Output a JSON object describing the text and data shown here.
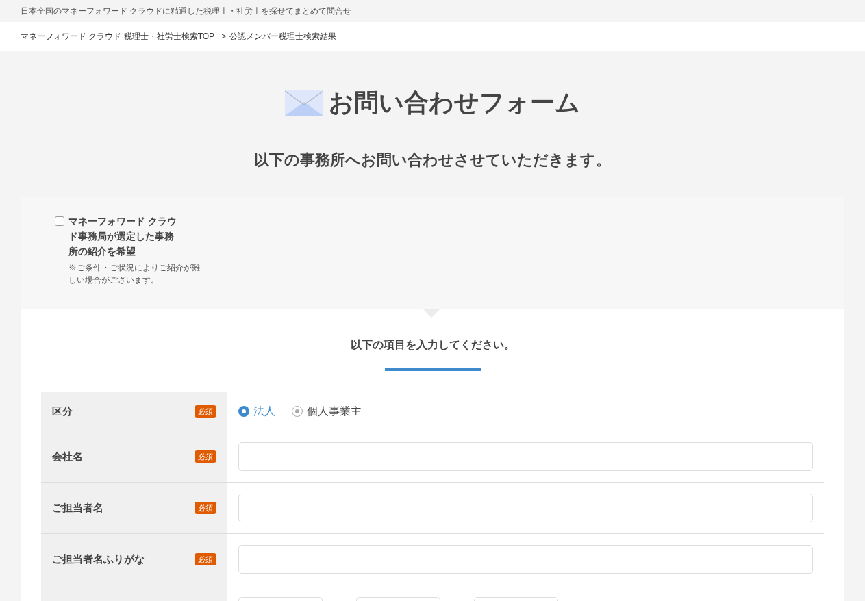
{
  "header": {
    "tagline": "日本全国のマネーフォワード クラウドに精通した税理士・社労士を探せてまとめて問合せ"
  },
  "breadcrumb": {
    "separator": ">",
    "items": [
      {
        "label": "マネーフォワード クラウド 税理士・社労士検索TOP"
      },
      {
        "label": "公認メンバー税理士検索結果"
      }
    ]
  },
  "page_title": "お問い合わせフォーム",
  "intro": "以下の事務所へお問い合わせさせていただきます。",
  "referral": {
    "label": "マネーフォワード クラウド事務局が選定した事務所の紹介を希望",
    "checked": false,
    "note": "※ご条件・ご状況によりご紹介が難しい場合がございます。"
  },
  "form": {
    "heading": "以下の項目を入力してください。",
    "rows": [
      {
        "kind": "radio",
        "label": "区分",
        "badge": "必須",
        "options": [
          {
            "label": "法人",
            "selected": true
          },
          {
            "label": "個人事業主",
            "selected": false
          }
        ]
      },
      {
        "kind": "text",
        "label": "会社名",
        "badge": "必須"
      },
      {
        "kind": "text",
        "label": "ご担当者名",
        "badge": "必須"
      },
      {
        "kind": "text",
        "label": "ご担当者名ふりがな",
        "badge": "必須"
      },
      {
        "kind": "split"
      }
    ]
  }
}
